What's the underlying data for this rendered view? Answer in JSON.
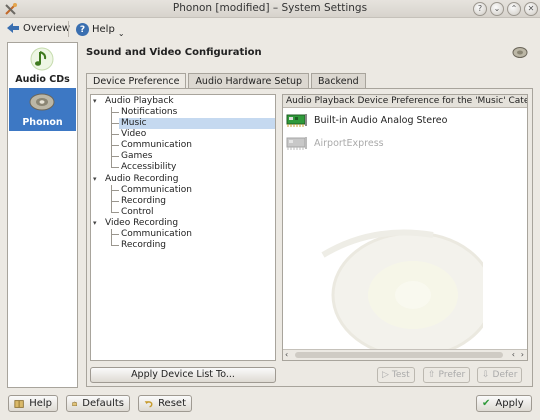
{
  "window": {
    "title": "Phonon [modified] – System Settings",
    "controls": [
      "help-icon",
      "minimize-icon",
      "maximize-icon",
      "close-icon"
    ]
  },
  "toolbar": {
    "overview_label": "Overview",
    "help_label": "Help"
  },
  "sidebar": {
    "items": [
      {
        "label": "Audio CDs",
        "icon": "music-note-icon"
      },
      {
        "label": "Phonon",
        "icon": "speaker-icon",
        "selected": true
      }
    ]
  },
  "header": {
    "title": "Sound and Video Configuration"
  },
  "tabs": [
    {
      "label": "Device Preference",
      "active": true
    },
    {
      "label": "Audio Hardware Setup",
      "active": false
    },
    {
      "label": "Backend",
      "active": false
    }
  ],
  "tree": {
    "groups": [
      {
        "label": "Audio Playback",
        "children": [
          "Notifications",
          "Music",
          "Video",
          "Communication",
          "Games",
          "Accessibility"
        ]
      },
      {
        "label": "Audio Recording",
        "children": [
          "Communication",
          "Recording",
          "Control"
        ]
      },
      {
        "label": "Video Recording",
        "children": [
          "Communication",
          "Recording"
        ]
      }
    ],
    "selected": "Music"
  },
  "device_panel": {
    "header": "Audio Playback Device Preference for the 'Music' Category",
    "devices": [
      {
        "name": "Built-in Audio Analog Stereo",
        "enabled": true
      },
      {
        "name": "AirportExpress",
        "enabled": false
      }
    ]
  },
  "buttons": {
    "apply_device_list": "Apply Device List To...",
    "test": "Test",
    "prefer": "Prefer",
    "defer": "Defer"
  },
  "footer": {
    "help": "Help",
    "defaults": "Defaults",
    "reset": "Reset",
    "apply": "Apply"
  },
  "colors": {
    "accent": "#3a6fb0",
    "selection": "#c5d9f0",
    "sidebar_selected": "#3d78c4",
    "card_green": "#2f9a3a"
  }
}
